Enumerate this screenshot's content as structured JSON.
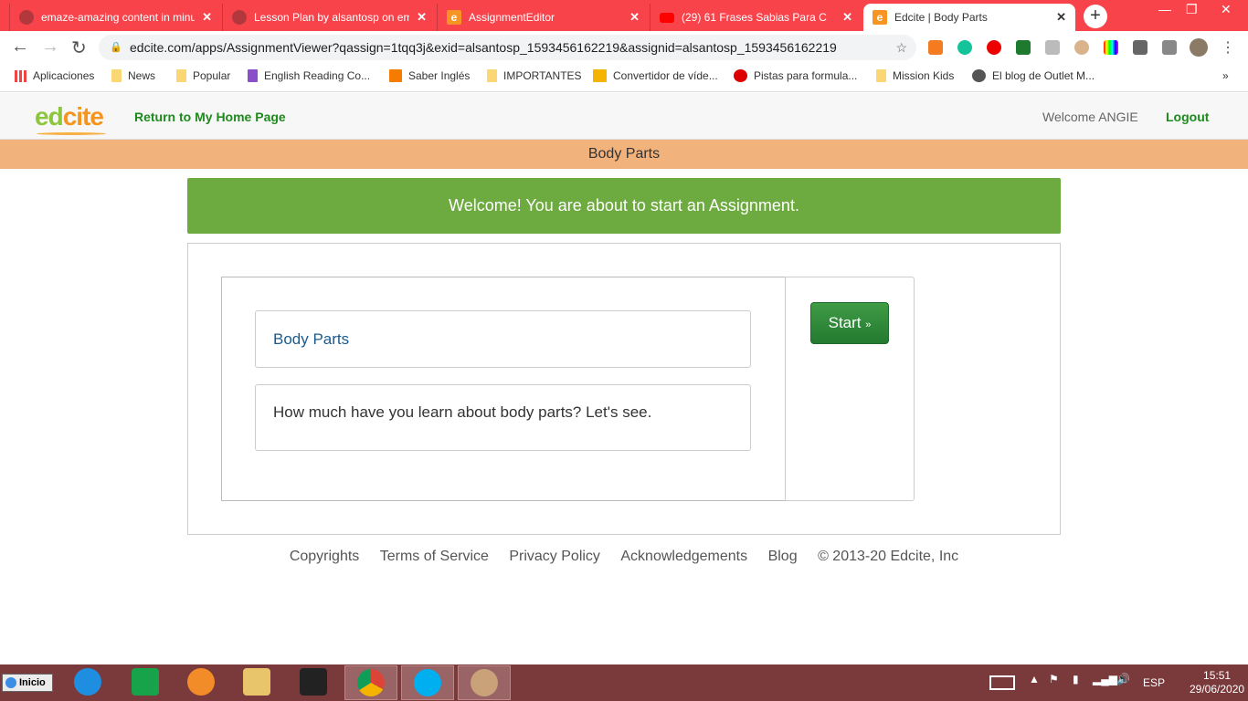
{
  "browser": {
    "tabs": [
      {
        "title": "emaze-amazing content in minu",
        "icon": "globe-icon"
      },
      {
        "title": "Lesson Plan by alsantosp on em",
        "icon": "globe-icon"
      },
      {
        "title": "AssignmentEditor",
        "icon": "edcite-icon"
      },
      {
        "title": "(29) 61 Frases Sabias Para C",
        "icon": "youtube-icon"
      },
      {
        "title": "Edcite | Body Parts",
        "icon": "edcite-icon",
        "active": true
      }
    ],
    "close_glyph": "✕",
    "new_tab": "+",
    "url": "edcite.com/apps/AssignmentViewer?qassign=1tqq3j&exid=alsantosp_1593456162219&assignid=alsantosp_1593456162219",
    "bookmarks": [
      "Aplicaciones",
      "News",
      "Popular",
      "English Reading Co...",
      "Saber Inglés",
      "IMPORTANTES",
      "Convertidor de víde...",
      "Pistas para formula...",
      "Mission Kids",
      "El blog de Outlet M..."
    ],
    "more": "»"
  },
  "header": {
    "logo_ed": "ed",
    "logo_cite": "cite",
    "home_link": "Return to My Home Page",
    "welcome": "Welcome ANGIE",
    "logout": "Logout"
  },
  "page": {
    "title": "Body Parts",
    "banner": "Welcome! You are about to start an Assignment.",
    "assignment_title": "Body Parts",
    "assignment_description": "How much have you learn about body parts? Let's see.",
    "start_label": "Start",
    "start_glyph": "»"
  },
  "footer": {
    "links": [
      "Copyrights",
      "Terms of Service",
      "Privacy Policy",
      "Acknowledgements",
      "Blog"
    ],
    "copyright": "© 2013-20 Edcite, Inc"
  },
  "taskbar": {
    "start": "Inicio",
    "lang": "ESP",
    "time": "15:51",
    "date": "29/06/2020"
  },
  "colors": {
    "tabbar": "#f8434b",
    "accent_green": "#6daa3f",
    "title_bar": "#f2b27c",
    "link_green": "#1e8a1e",
    "taskbar": "#7a393b"
  }
}
